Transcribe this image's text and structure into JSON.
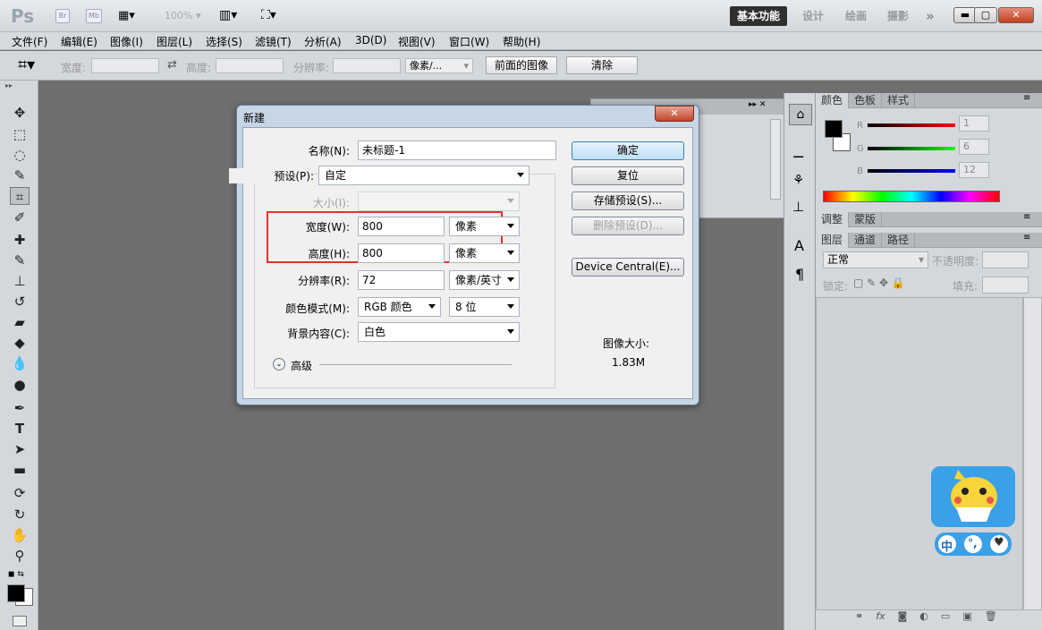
{
  "app": {
    "logo": "Ps",
    "bridge_label": "Br",
    "minibridge_label": "Mb",
    "zoom": "100%",
    "workspaces": [
      "基本功能",
      "设计",
      "绘画",
      "摄影"
    ],
    "more_label": "»"
  },
  "menu": [
    "文件(F)",
    "编辑(E)",
    "图像(I)",
    "图层(L)",
    "选择(S)",
    "滤镜(T)",
    "分析(A)",
    "3D(D)",
    "视图(V)",
    "窗口(W)",
    "帮助(H)"
  ],
  "options": {
    "width_label": "宽度:",
    "height_label": "高度:",
    "resolution_label": "分辨率:",
    "unit": "像素/...",
    "front_image_btn": "前面的图像",
    "clear_btn": "清除"
  },
  "dialog": {
    "title": "新建",
    "name_label": "名称(N):",
    "name_value": "未标题-1",
    "preset_label": "预设(P):",
    "preset_value": "自定",
    "size_label": "大小(I):",
    "width_label": "宽度(W):",
    "width_value": "800",
    "width_unit": "像素",
    "height_label": "高度(H):",
    "height_value": "800",
    "height_unit": "像素",
    "resolution_label": "分辨率(R):",
    "resolution_value": "72",
    "resolution_unit": "像素/英寸",
    "color_mode_label": "颜色模式(M):",
    "color_mode_value": "RGB 颜色",
    "bit_depth": "8 位",
    "bg_label": "背景内容(C):",
    "bg_value": "白色",
    "advanced_label": "高级",
    "ok": "确定",
    "reset": "复位",
    "save_preset": "存储预设(S)...",
    "delete_preset": "删除预设(D)...",
    "device_central": "Device Central(E)...",
    "image_size_label": "图像大小:",
    "image_size_value": "1.83M"
  },
  "panels": {
    "color_tabs": [
      "颜色",
      "色板",
      "样式"
    ],
    "r_label": "R",
    "g_label": "G",
    "b_label": "B",
    "r_value": "1",
    "g_value": "6",
    "b_value": "12",
    "adjust_tabs": [
      "调整",
      "蒙版"
    ],
    "layer_tabs": [
      "图层",
      "通道",
      "路径"
    ],
    "blend_mode": "正常",
    "opacity_label": "不透明度:",
    "lock_label": "锁定:",
    "fill_label": "填充:",
    "fx_label": "fx"
  },
  "mascot": {
    "keys": [
      "中",
      "°,",
      "♥"
    ]
  },
  "colors": {
    "highlight": "#e0342b",
    "accent": "#3c7fb1"
  }
}
